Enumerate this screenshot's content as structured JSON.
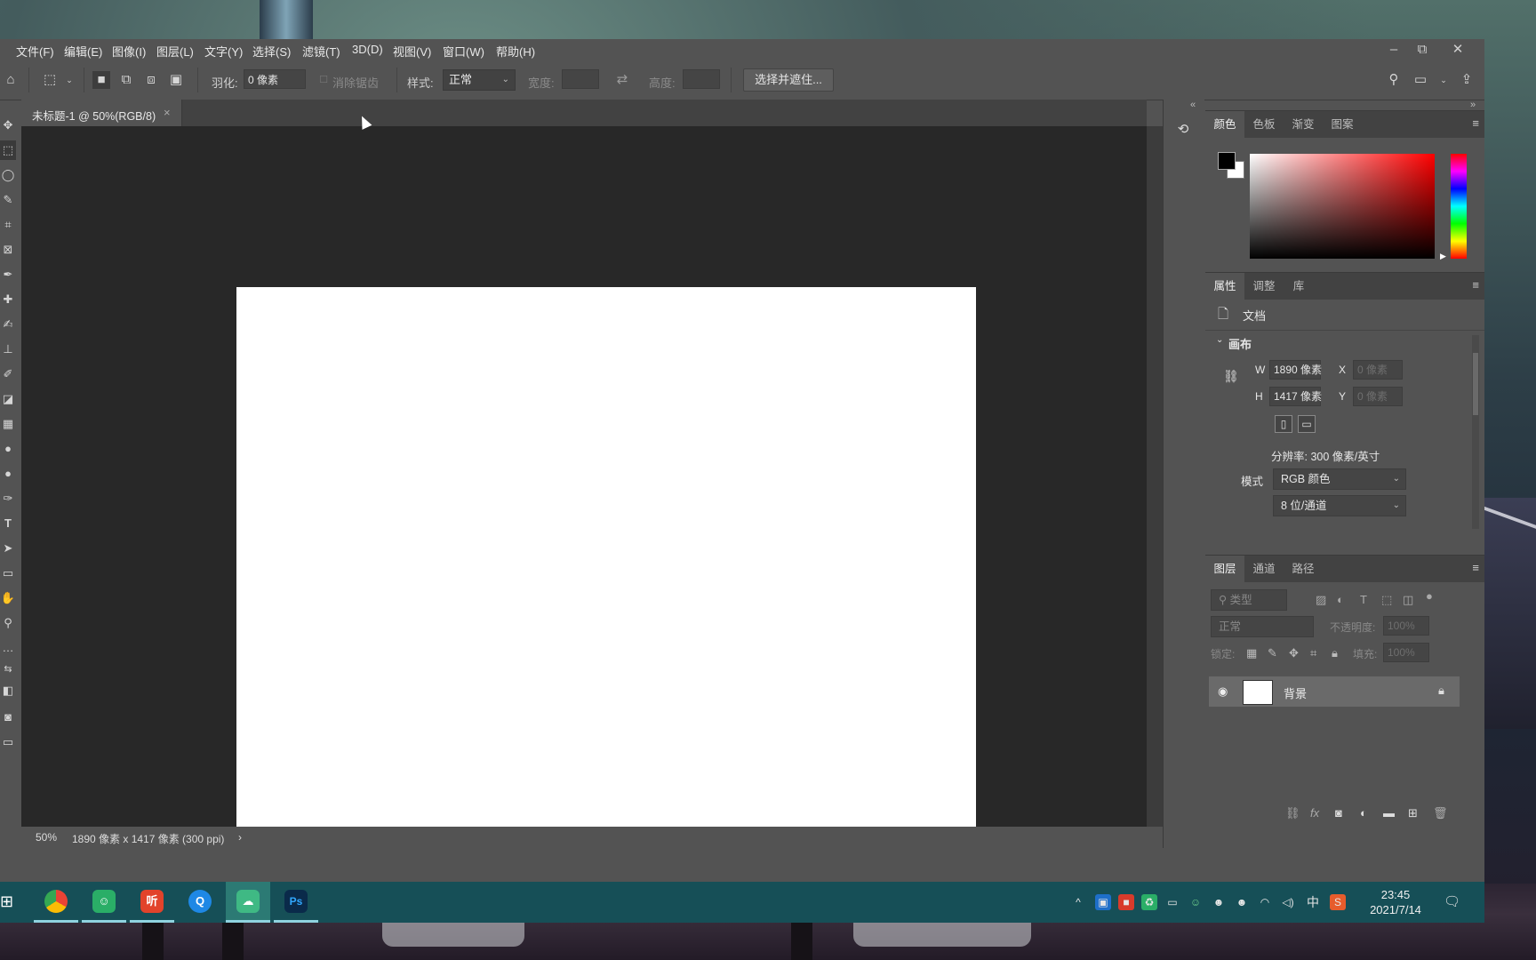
{
  "menubar": {
    "items": [
      "文件(F)",
      "编辑(E)",
      "图像(I)",
      "图层(L)",
      "文字(Y)",
      "选择(S)",
      "滤镜(T)",
      "3D(D)",
      "视图(V)",
      "窗口(W)",
      "帮助(H)"
    ]
  },
  "window_controls": {
    "minimize": "–",
    "restore": "⧉",
    "close": "✕"
  },
  "options": {
    "feather_label": "羽化:",
    "feather_value": "0 像素",
    "antialias_label": "消除锯齿",
    "style_label": "样式:",
    "style_value": "正常",
    "width_label": "宽度:",
    "height_label": "高度:",
    "select_mask_button": "选择并遮住..."
  },
  "document": {
    "tab_title": "未标题-1 @ 50%(RGB/8)",
    "tab_close": "×"
  },
  "status": {
    "zoom": "50%",
    "info": "1890 像素 x 1417 像素 (300 ppi)",
    "arrow": "›"
  },
  "color_panel": {
    "tabs": [
      "颜色",
      "色板",
      "渐变",
      "图案"
    ],
    "active_tab": "颜色",
    "foreground": "#000000",
    "background": "#ffffff"
  },
  "properties_panel": {
    "tabs": [
      "属性",
      "调整",
      "库"
    ],
    "doc_label": "文档",
    "section_title": "画布",
    "w_label": "W",
    "w_value": "1890 像素",
    "h_label": "H",
    "h_value": "1417 像素",
    "x_label": "X",
    "x_value": "0 像素",
    "y_label": "Y",
    "y_value": "0 像素",
    "resolution": "分辨率: 300 像素/英寸",
    "mode_label": "模式",
    "mode_value": "RGB 颜色",
    "depth_value": "8 位/通道"
  },
  "layers_panel": {
    "tabs": [
      "图层",
      "通道",
      "路径"
    ],
    "filter_placeholder": "类型",
    "blend_mode": "正常",
    "opacity_label": "不透明度:",
    "opacity_value": "100%",
    "lock_label": "锁定:",
    "fill_label": "填充:",
    "fill_value": "100%",
    "layers": [
      {
        "name": "背景",
        "visible": true,
        "locked": true
      }
    ]
  },
  "taskbar": {
    "time": "23:45",
    "date": "2021/7/14",
    "ime": "中",
    "apps": [
      "chrome",
      "wechat",
      "tingshu",
      "qq-browser",
      "cloud-sync",
      "photoshop"
    ]
  }
}
